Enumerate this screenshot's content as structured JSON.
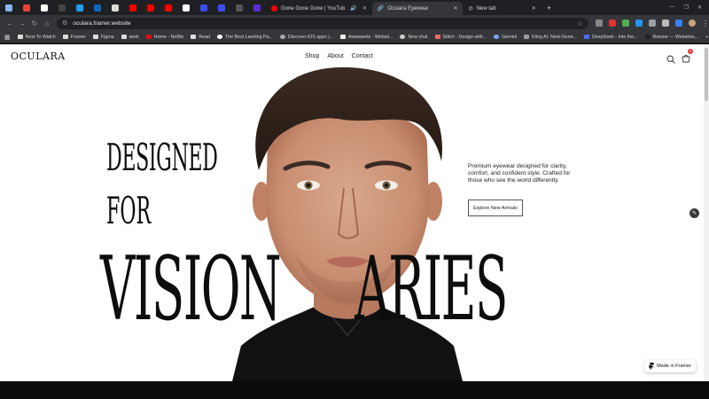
{
  "browser": {
    "tabs": [
      {
        "title": "Gone Gone Gone | YouTub",
        "active": false
      },
      {
        "title": "Ocularа Eyewear",
        "active": true
      },
      {
        "title": "New tab",
        "active": false
      }
    ],
    "new_tab_symbol": "+",
    "url": "oculara.framer.website",
    "bookmarks": [
      "Next To Watch",
      "Framer",
      "Figma",
      "work",
      "Home - Netflix",
      "Read",
      "The Best Landing Pa...",
      "Discover iOS apps |...",
      "Awwwards - Websit...",
      "New chat",
      "Stitch - Design with...",
      "Gemini",
      "Kling AI: Next-Gene...",
      "DeepSeek - Into the...",
      "Retune — Websites..."
    ],
    "bookmarks_more": "»",
    "colors": {
      "tab_bar": "#1f2023",
      "toolbar": "#35363a",
      "omnibox": "#202124"
    }
  },
  "site": {
    "logo": "OCULARA",
    "nav": [
      "Shop",
      "About",
      "Contact"
    ],
    "cart_count": "2",
    "hero": {
      "line1": "DESIGNED",
      "line2": "FOR",
      "line3_left": "VISION",
      "line3_right": "ARIES",
      "blurb": "Premium eyewear designed for clarity, comfort, and confident style. Crafted for those who see the world differently.",
      "cta": "Explore New Arrivals"
    },
    "framer_badge": "Made in Framer"
  }
}
